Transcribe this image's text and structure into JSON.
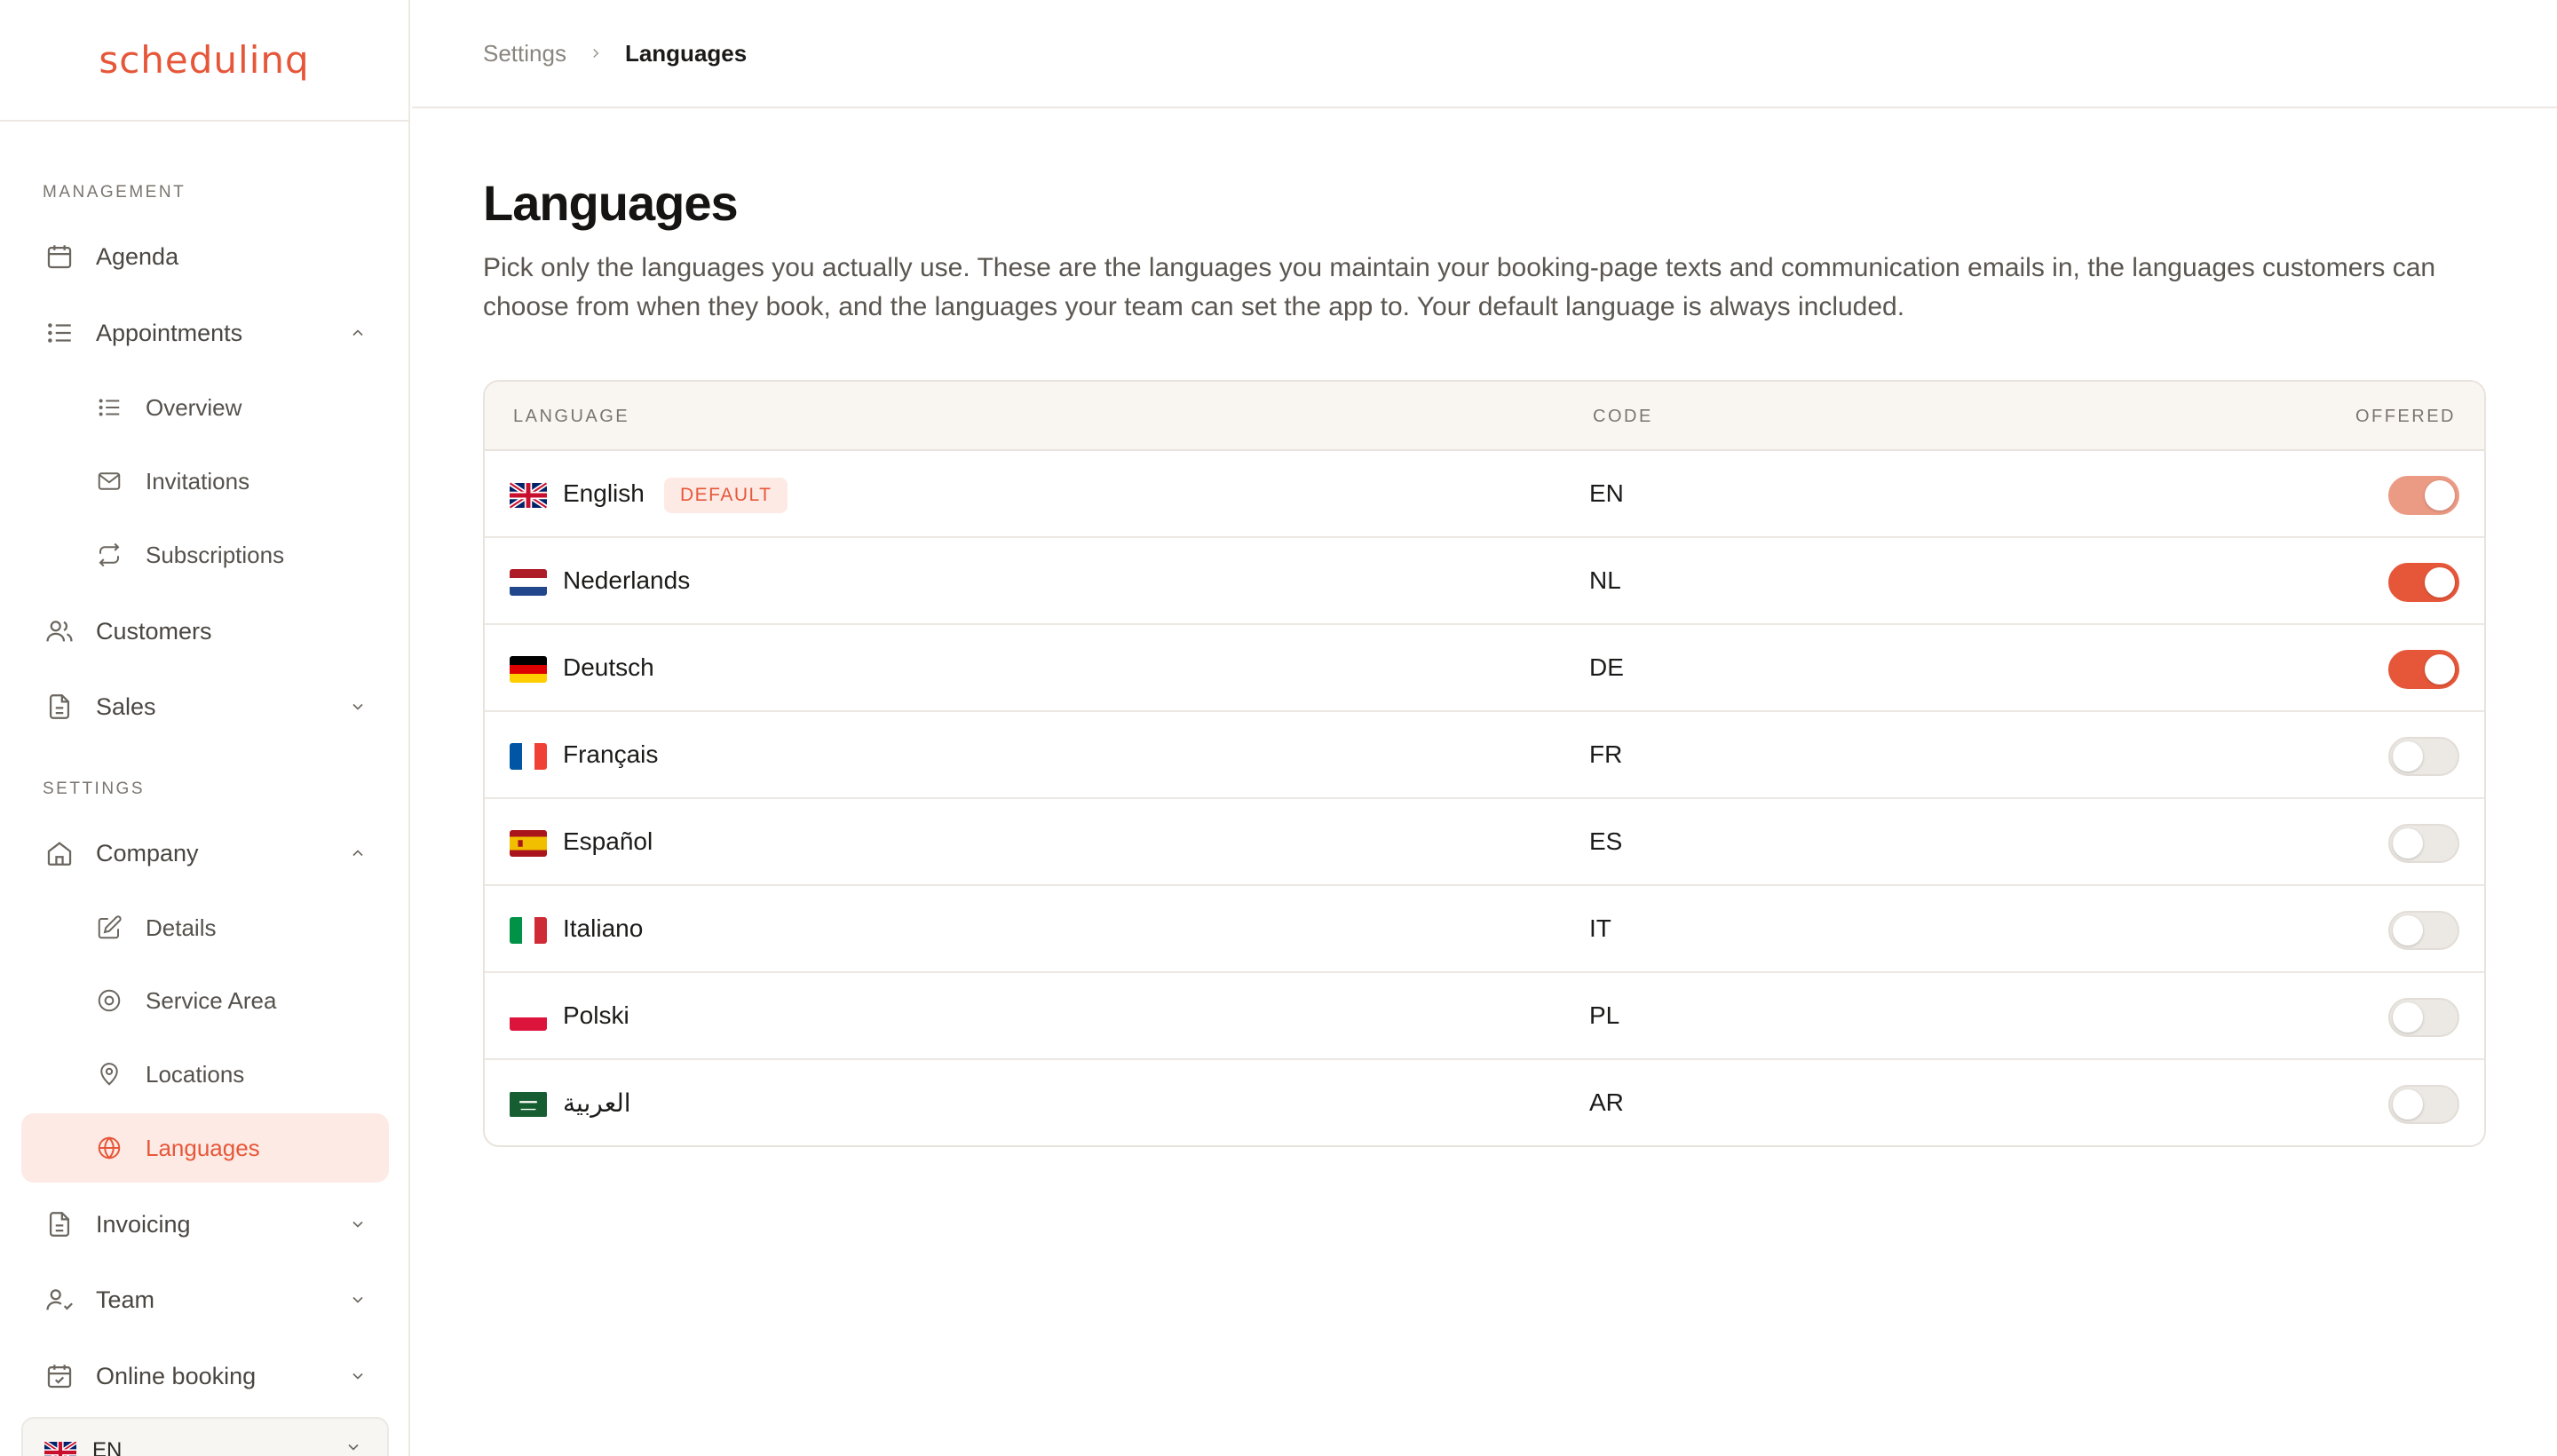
{
  "logo": "schedulinq",
  "sidebar": {
    "management_label": "MANAGEMENT",
    "settings_label": "SETTINGS",
    "items": {
      "agenda": "Agenda",
      "appointments": "Appointments",
      "overview": "Overview",
      "invitations": "Invitations",
      "subscriptions": "Subscriptions",
      "customers": "Customers",
      "sales": "Sales",
      "company": "Company",
      "details": "Details",
      "service_area": "Service Area",
      "locations": "Locations",
      "languages": "Languages",
      "invoicing": "Invoicing",
      "team": "Team",
      "online_booking": "Online booking"
    },
    "language_selector": {
      "code": "EN",
      "flag": "uk"
    }
  },
  "breadcrumb": {
    "parent": "Settings",
    "current": "Languages"
  },
  "page": {
    "title": "Languages",
    "description": "Pick only the languages you actually use. These are the languages you maintain your booking-page texts and communication emails in, the languages customers can choose from when they book, and the languages your team can set the app to. Your default language is always included."
  },
  "table": {
    "headers": {
      "language": "LANGUAGE",
      "code": "CODE",
      "offered": "OFFERED"
    },
    "rows": [
      {
        "name": "English",
        "code": "EN",
        "flag": "uk",
        "badge": "DEFAULT",
        "offered": true,
        "locked": true
      },
      {
        "name": "Nederlands",
        "code": "NL",
        "flag": "nl",
        "badge": "",
        "offered": true,
        "locked": false
      },
      {
        "name": "Deutsch",
        "code": "DE",
        "flag": "de",
        "badge": "",
        "offered": true,
        "locked": false
      },
      {
        "name": "Français",
        "code": "FR",
        "flag": "fr",
        "badge": "",
        "offered": false,
        "locked": false
      },
      {
        "name": "Español",
        "code": "ES",
        "flag": "es",
        "badge": "",
        "offered": false,
        "locked": false
      },
      {
        "name": "Italiano",
        "code": "IT",
        "flag": "it",
        "badge": "",
        "offered": false,
        "locked": false
      },
      {
        "name": "Polski",
        "code": "PL",
        "flag": "pl",
        "badge": "",
        "offered": false,
        "locked": false
      },
      {
        "name": "العربية",
        "code": "AR",
        "flag": "sa",
        "badge": "",
        "offered": false,
        "locked": false
      }
    ]
  },
  "colors": {
    "accent": "#e6573a",
    "accent_soft": "#fdeae4",
    "locked_toggle": "#eb9a84"
  }
}
